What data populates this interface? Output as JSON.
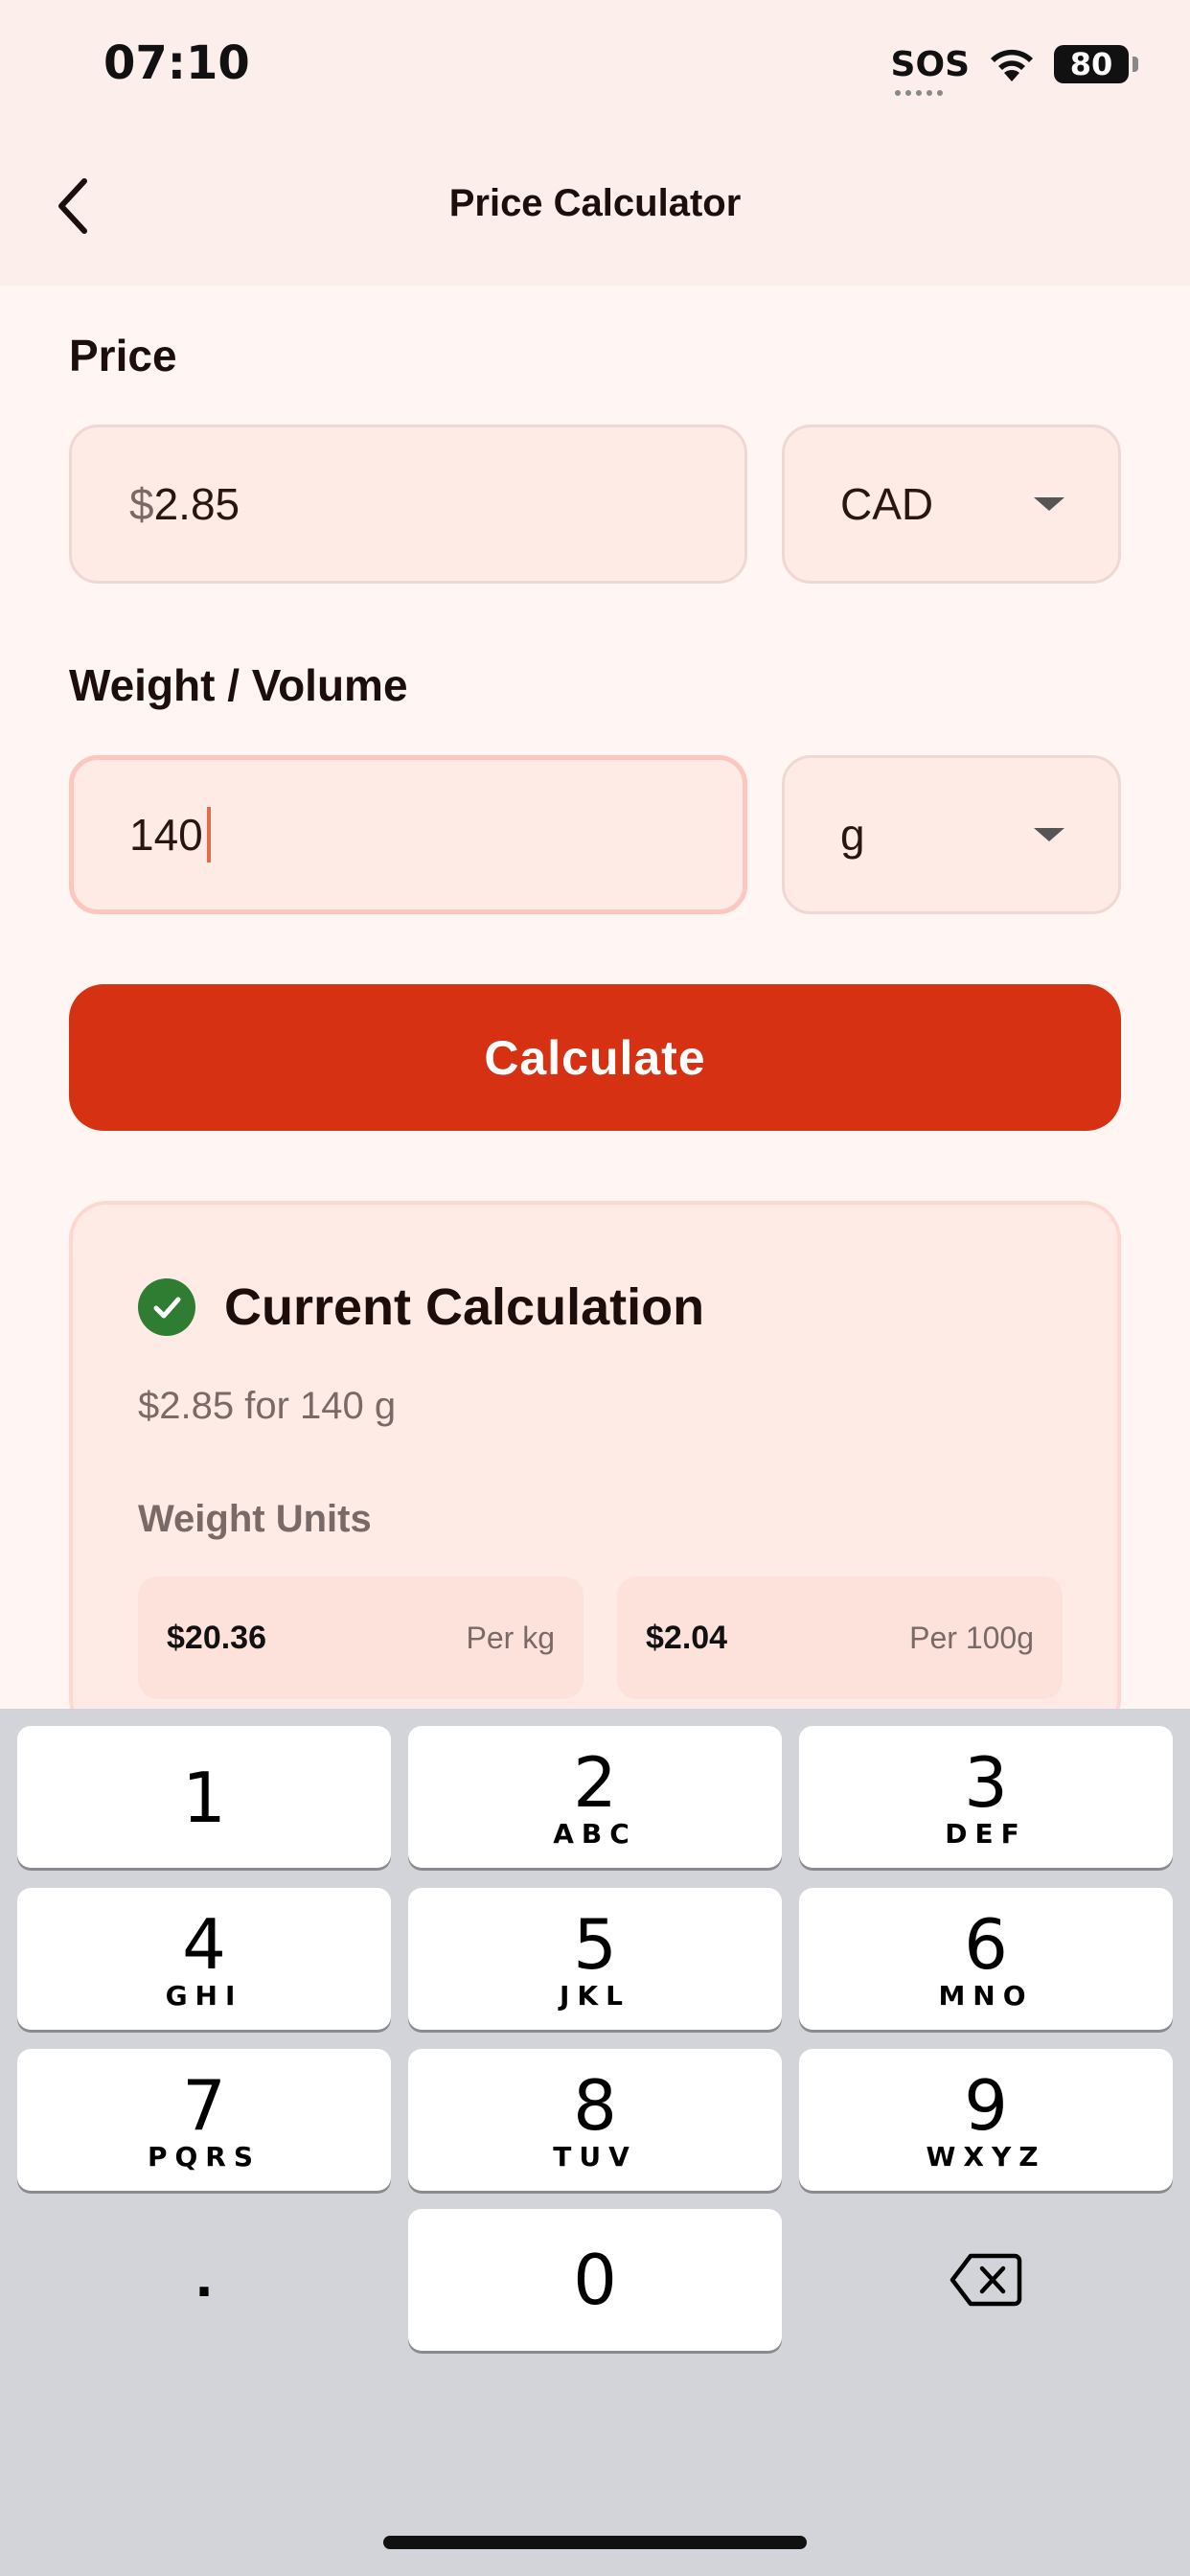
{
  "status_bar": {
    "time": "07:10",
    "sos": "SOS",
    "battery": "80"
  },
  "header": {
    "title": "Price Calculator"
  },
  "price": {
    "label": "Price",
    "currency_symbol": "$",
    "value": "2.85",
    "currency": "CAD"
  },
  "weight": {
    "label": "Weight / Volume",
    "value": "140",
    "unit": "g"
  },
  "calculate_label": "Calculate",
  "result": {
    "title": "Current Calculation",
    "summary": "$2.85 for 140 g",
    "section": "Weight Units",
    "units": [
      {
        "value": "$20.36",
        "label": "Per kg"
      },
      {
        "value": "$2.04",
        "label": "Per 100g"
      }
    ]
  },
  "keypad": {
    "keys": [
      {
        "num": "1",
        "letters": ""
      },
      {
        "num": "2",
        "letters": "ABC"
      },
      {
        "num": "3",
        "letters": "DEF"
      },
      {
        "num": "4",
        "letters": "GHI"
      },
      {
        "num": "5",
        "letters": "JKL"
      },
      {
        "num": "6",
        "letters": "MNO"
      },
      {
        "num": "7",
        "letters": "PQRS"
      },
      {
        "num": "8",
        "letters": "TUV"
      },
      {
        "num": "9",
        "letters": "WXYZ"
      },
      {
        "num": "0",
        "letters": ""
      }
    ],
    "decimal": "."
  },
  "colors": {
    "accent": "#D63112",
    "background": "#FFF5F2",
    "field_fill": "#FFEBE6",
    "success": "#2E7D32"
  }
}
